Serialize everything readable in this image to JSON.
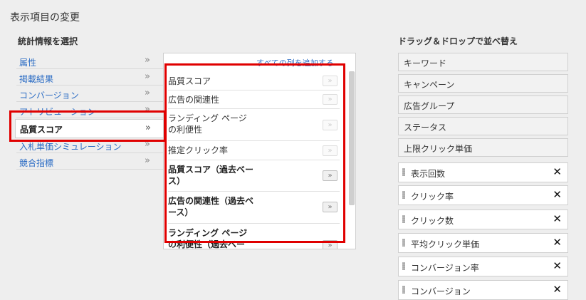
{
  "page_title": "表示項目の変更",
  "stats_heading": "統計情報を選択",
  "dnd_heading": "ドラッグ＆ドロップで並べ替え",
  "categories": [
    {
      "label": "属性",
      "chevron": "»"
    },
    {
      "label": "掲載結果",
      "chevron": "»"
    },
    {
      "label": "コンバージョン",
      "chevron": "»"
    },
    {
      "label": "アトリビューション",
      "chevron": "»"
    },
    {
      "label": "品質スコア",
      "chevron": "»"
    },
    {
      "label": "入札単価シミュレーション",
      "chevron": "»"
    },
    {
      "label": "競合指標",
      "chevron": "»"
    }
  ],
  "add_all_label": "すべての列を追加する",
  "metrics": [
    {
      "label": "品質スコア",
      "button": "»"
    },
    {
      "label": "広告の関連性",
      "button": "»"
    },
    {
      "label": "ランディング ページ\nの利便性",
      "button": "»"
    },
    {
      "label": "推定クリック率",
      "button": "»"
    },
    {
      "label": "品質スコア（過去ベー\nス）",
      "button": "»"
    },
    {
      "label": "広告の関連性（過去ベ\nース）",
      "button": "»"
    },
    {
      "label": "ランディング ページ\nの利便性（過去ベー",
      "button": "»"
    }
  ],
  "fixed_columns": [
    "キーワード",
    "キャンペーン",
    "広告グループ",
    "ステータス",
    "上限クリック単価"
  ],
  "selected_columns": [
    "表示回数",
    "クリック率",
    "クリック数",
    "平均クリック単価",
    "コンバージョン率",
    "コンバージョン"
  ],
  "remove_symbol": "✕",
  "colors": {
    "link": "#2b6cc4",
    "highlight": "#e00000",
    "background": "#eeeeee"
  }
}
